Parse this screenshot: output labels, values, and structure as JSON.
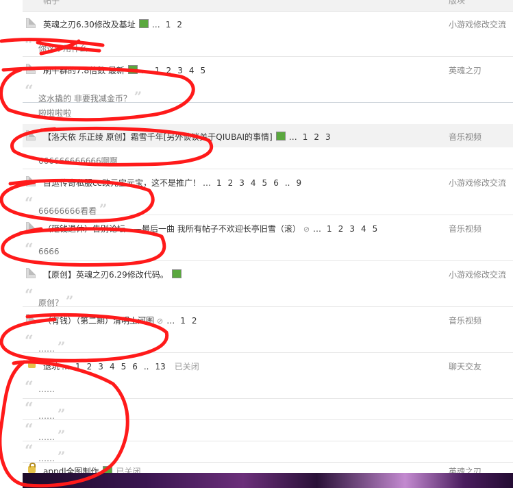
{
  "header": {
    "col_post": "帖子",
    "col_forum": "版块"
  },
  "posts": [
    {
      "title": "英魂之刃6.30修改及基址",
      "has_image": true,
      "pages": [
        "1",
        "2"
      ],
      "forum": "小游戏修改交流",
      "reply": "你这个用什么",
      "highlight": false
    },
    {
      "title": "刷牛群的7.8倍数 最新",
      "has_image": true,
      "pages": [
        "1",
        "2",
        "3",
        "4",
        "5"
      ],
      "forum": "英魂之刃",
      "reply": "这水撬的 非要我减金币？",
      "reply2": "啦啦啦啦",
      "highlight": false
    },
    {
      "title": "【洛天依 乐正绫 原创】霜雪千年[另外谈谈关于QIUBAI的事情]",
      "has_image": true,
      "pages": [
        "1",
        "2",
        "3"
      ],
      "forum": "音乐视频",
      "reply": "666666666666啊啊",
      "highlight": true
    },
    {
      "title": "百运传奇私服ce改元宝元宝，这不是推广！",
      "pages": [
        "1",
        "2",
        "3",
        "4",
        "5",
        "6"
      ],
      "last_page": "9",
      "forum": "小游戏修改交流",
      "reply": "66666666看看"
    },
    {
      "title": "（砸钱退休）告别论坛——最后一曲 我所有帖子不欢迎长亭旧雪（滚）",
      "has_attachment": true,
      "pages": [
        "1",
        "2",
        "3",
        "4",
        "5"
      ],
      "forum": "音乐视频",
      "reply": "6666"
    },
    {
      "title": "【原创】英魂之刃6.29修改代码。",
      "has_image": true,
      "forum": "小游戏修改交流",
      "reply": "原创？"
    },
    {
      "title": "（有钱）（第二期）清明上河图",
      "has_attachment": true,
      "pages": [
        "1",
        "2"
      ],
      "forum": "音乐视频",
      "reply": "……"
    },
    {
      "title": "退坑",
      "locked": true,
      "pages": [
        "1",
        "2",
        "3",
        "4",
        "5",
        "6"
      ],
      "last_page": "13",
      "closed_text": "已关闭",
      "forum": "聊天交友",
      "reply": "……",
      "extra_replies": [
        "……",
        "……",
        "……"
      ]
    },
    {
      "title": "appdl全图制作",
      "locked": true,
      "has_image": true,
      "closed_text": "已关闭",
      "forum": "英魂之刃"
    }
  ],
  "colors": {
    "annotation_red": "#ff1a1a",
    "row_highlight": "#f2f2f2",
    "quote_gray": "#d6d6d6"
  },
  "ellipsis": "…",
  "page_ellipsis": ".."
}
